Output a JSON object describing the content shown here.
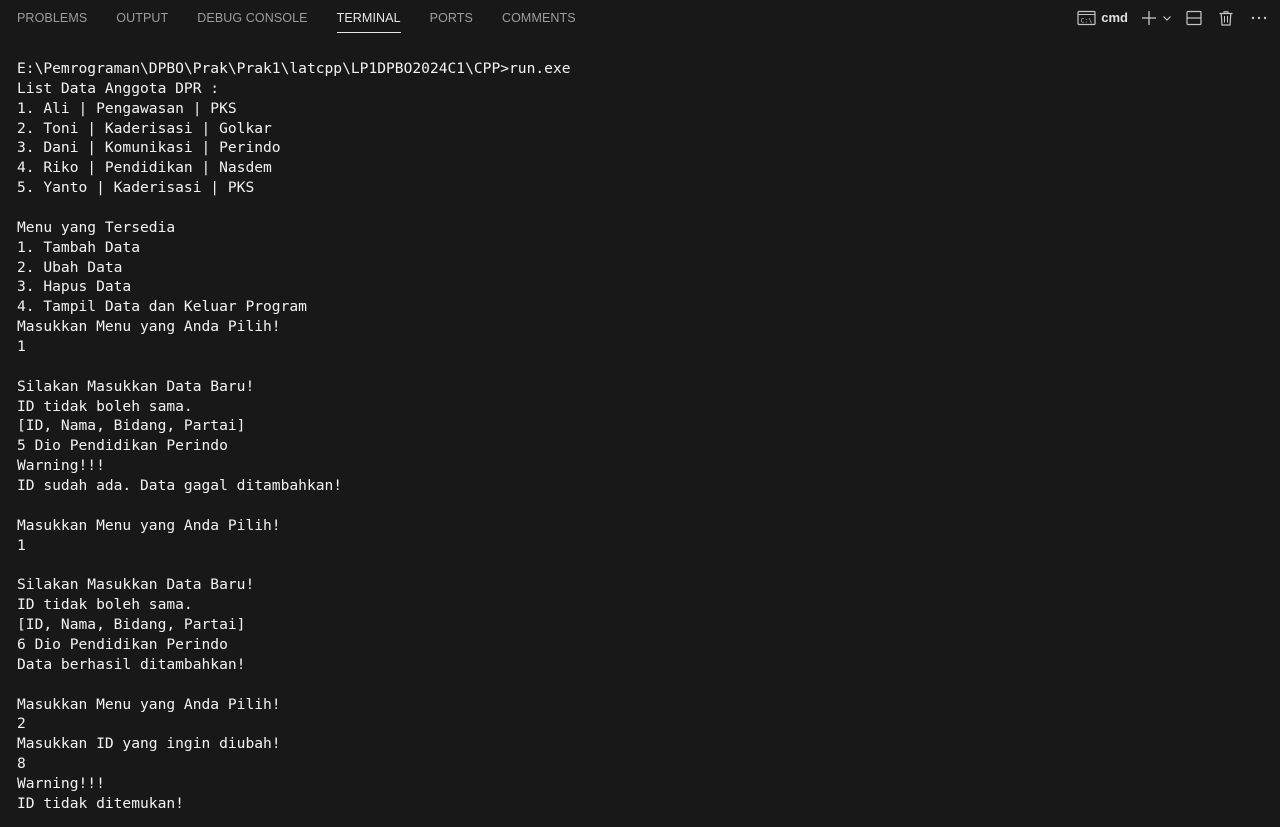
{
  "panel": {
    "tabs": [
      {
        "label": "PROBLEMS",
        "active": false
      },
      {
        "label": "OUTPUT",
        "active": false
      },
      {
        "label": "DEBUG CONSOLE",
        "active": false
      },
      {
        "label": "TERMINAL",
        "active": true
      },
      {
        "label": "PORTS",
        "active": false
      },
      {
        "label": "COMMENTS",
        "active": false
      }
    ],
    "terminal_profile": "cmd",
    "accent_color": "#e7e7e7",
    "icons": [
      "terminal-icon",
      "plus-icon",
      "chevron-down-icon",
      "split-icon",
      "trash-icon",
      "more-icon"
    ]
  },
  "terminal": {
    "lines": [
      "E:\\Pemrograman\\DPBO\\Prak\\Prak1\\latcpp\\LP1DPBO2024C1\\CPP>run.exe",
      "List Data Anggota DPR :",
      "1. Ali | Pengawasan | PKS",
      "2. Toni | Kaderisasi | Golkar",
      "3. Dani | Komunikasi | Perindo",
      "4. Riko | Pendidikan | Nasdem",
      "5. Yanto | Kaderisasi | PKS",
      "",
      "Menu yang Tersedia",
      "1. Tambah Data",
      "2. Ubah Data",
      "3. Hapus Data",
      "4. Tampil Data dan Keluar Program",
      "Masukkan Menu yang Anda Pilih!",
      "1",
      "",
      "Silakan Masukkan Data Baru!",
      "ID tidak boleh sama.",
      "[ID, Nama, Bidang, Partai]",
      "5 Dio Pendidikan Perindo",
      "Warning!!!",
      "ID sudah ada. Data gagal ditambahkan!",
      "",
      "Masukkan Menu yang Anda Pilih!",
      "1",
      "",
      "Silakan Masukkan Data Baru!",
      "ID tidak boleh sama.",
      "[ID, Nama, Bidang, Partai]",
      "6 Dio Pendidikan Perindo",
      "Data berhasil ditambahkan!",
      "",
      "Masukkan Menu yang Anda Pilih!",
      "2",
      "Masukkan ID yang ingin diubah!",
      "8",
      "Warning!!!",
      "ID tidak ditemukan!"
    ]
  }
}
